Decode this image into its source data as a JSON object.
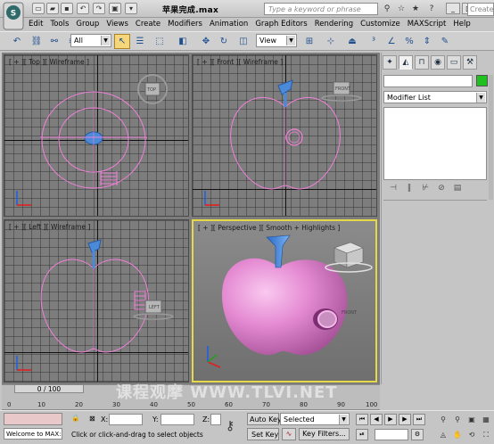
{
  "window": {
    "file_title": "苹果完成.max",
    "search_placeholder": "Type a keyword or phrase",
    "min": "_",
    "max": "□",
    "close": "×"
  },
  "menu": [
    "Edit",
    "Tools",
    "Group",
    "Views",
    "Create",
    "Modifiers",
    "Animation",
    "Graph Editors",
    "Rendering",
    "Customize",
    "MAXScript",
    "Help"
  ],
  "toolbar": {
    "filter_value": "All",
    "coord_value": "View",
    "create_selection_placeholder": "Create"
  },
  "viewports": {
    "top_label": "[ + ][ Top ][ Wireframe ]",
    "front_label": "[ + ][ Front ][ Wireframe ]",
    "left_label": "[ + ][ Left ][ Wireframe ]",
    "persp_label": "[ + ][ Perspective ][ Smooth + Highlights ]",
    "top_cube": "TOP",
    "front_cube": "FRONT",
    "left_cube": "LEFT",
    "persp_cube": "FRONT"
  },
  "command_panel": {
    "modifier_list": "Modifier List"
  },
  "timeline": {
    "position": "0 / 100",
    "ticks": [
      "0",
      "10",
      "20",
      "30",
      "40",
      "50",
      "60",
      "70",
      "80",
      "90",
      "100"
    ]
  },
  "status": {
    "welcome": "Welcome to MAX:",
    "prompt": "Click or click-and-drag to select objects",
    "x_label": "X:",
    "y_label": "Y:",
    "z_label": "Z:",
    "auto_key": "Auto Key",
    "set_key": "Set Key",
    "key_mode": "Selected",
    "key_filters": "Key Filters..."
  },
  "watermark": "课程观摩 WWW.TLVI.NET",
  "colors": {
    "accent_active_viewport": "#e7d84a",
    "apple_wire": "#f080d8",
    "apple_shaded": "#e27fd0",
    "stem": "#4a8ad8",
    "object_color": "#20c020"
  },
  "icons": {
    "app_logo": "3ds-max-logo-icon",
    "select": "select-arrow-icon",
    "move": "move-icon",
    "rotate": "rotate-icon",
    "scale": "scale-icon",
    "render": "teapot-render-icon"
  }
}
